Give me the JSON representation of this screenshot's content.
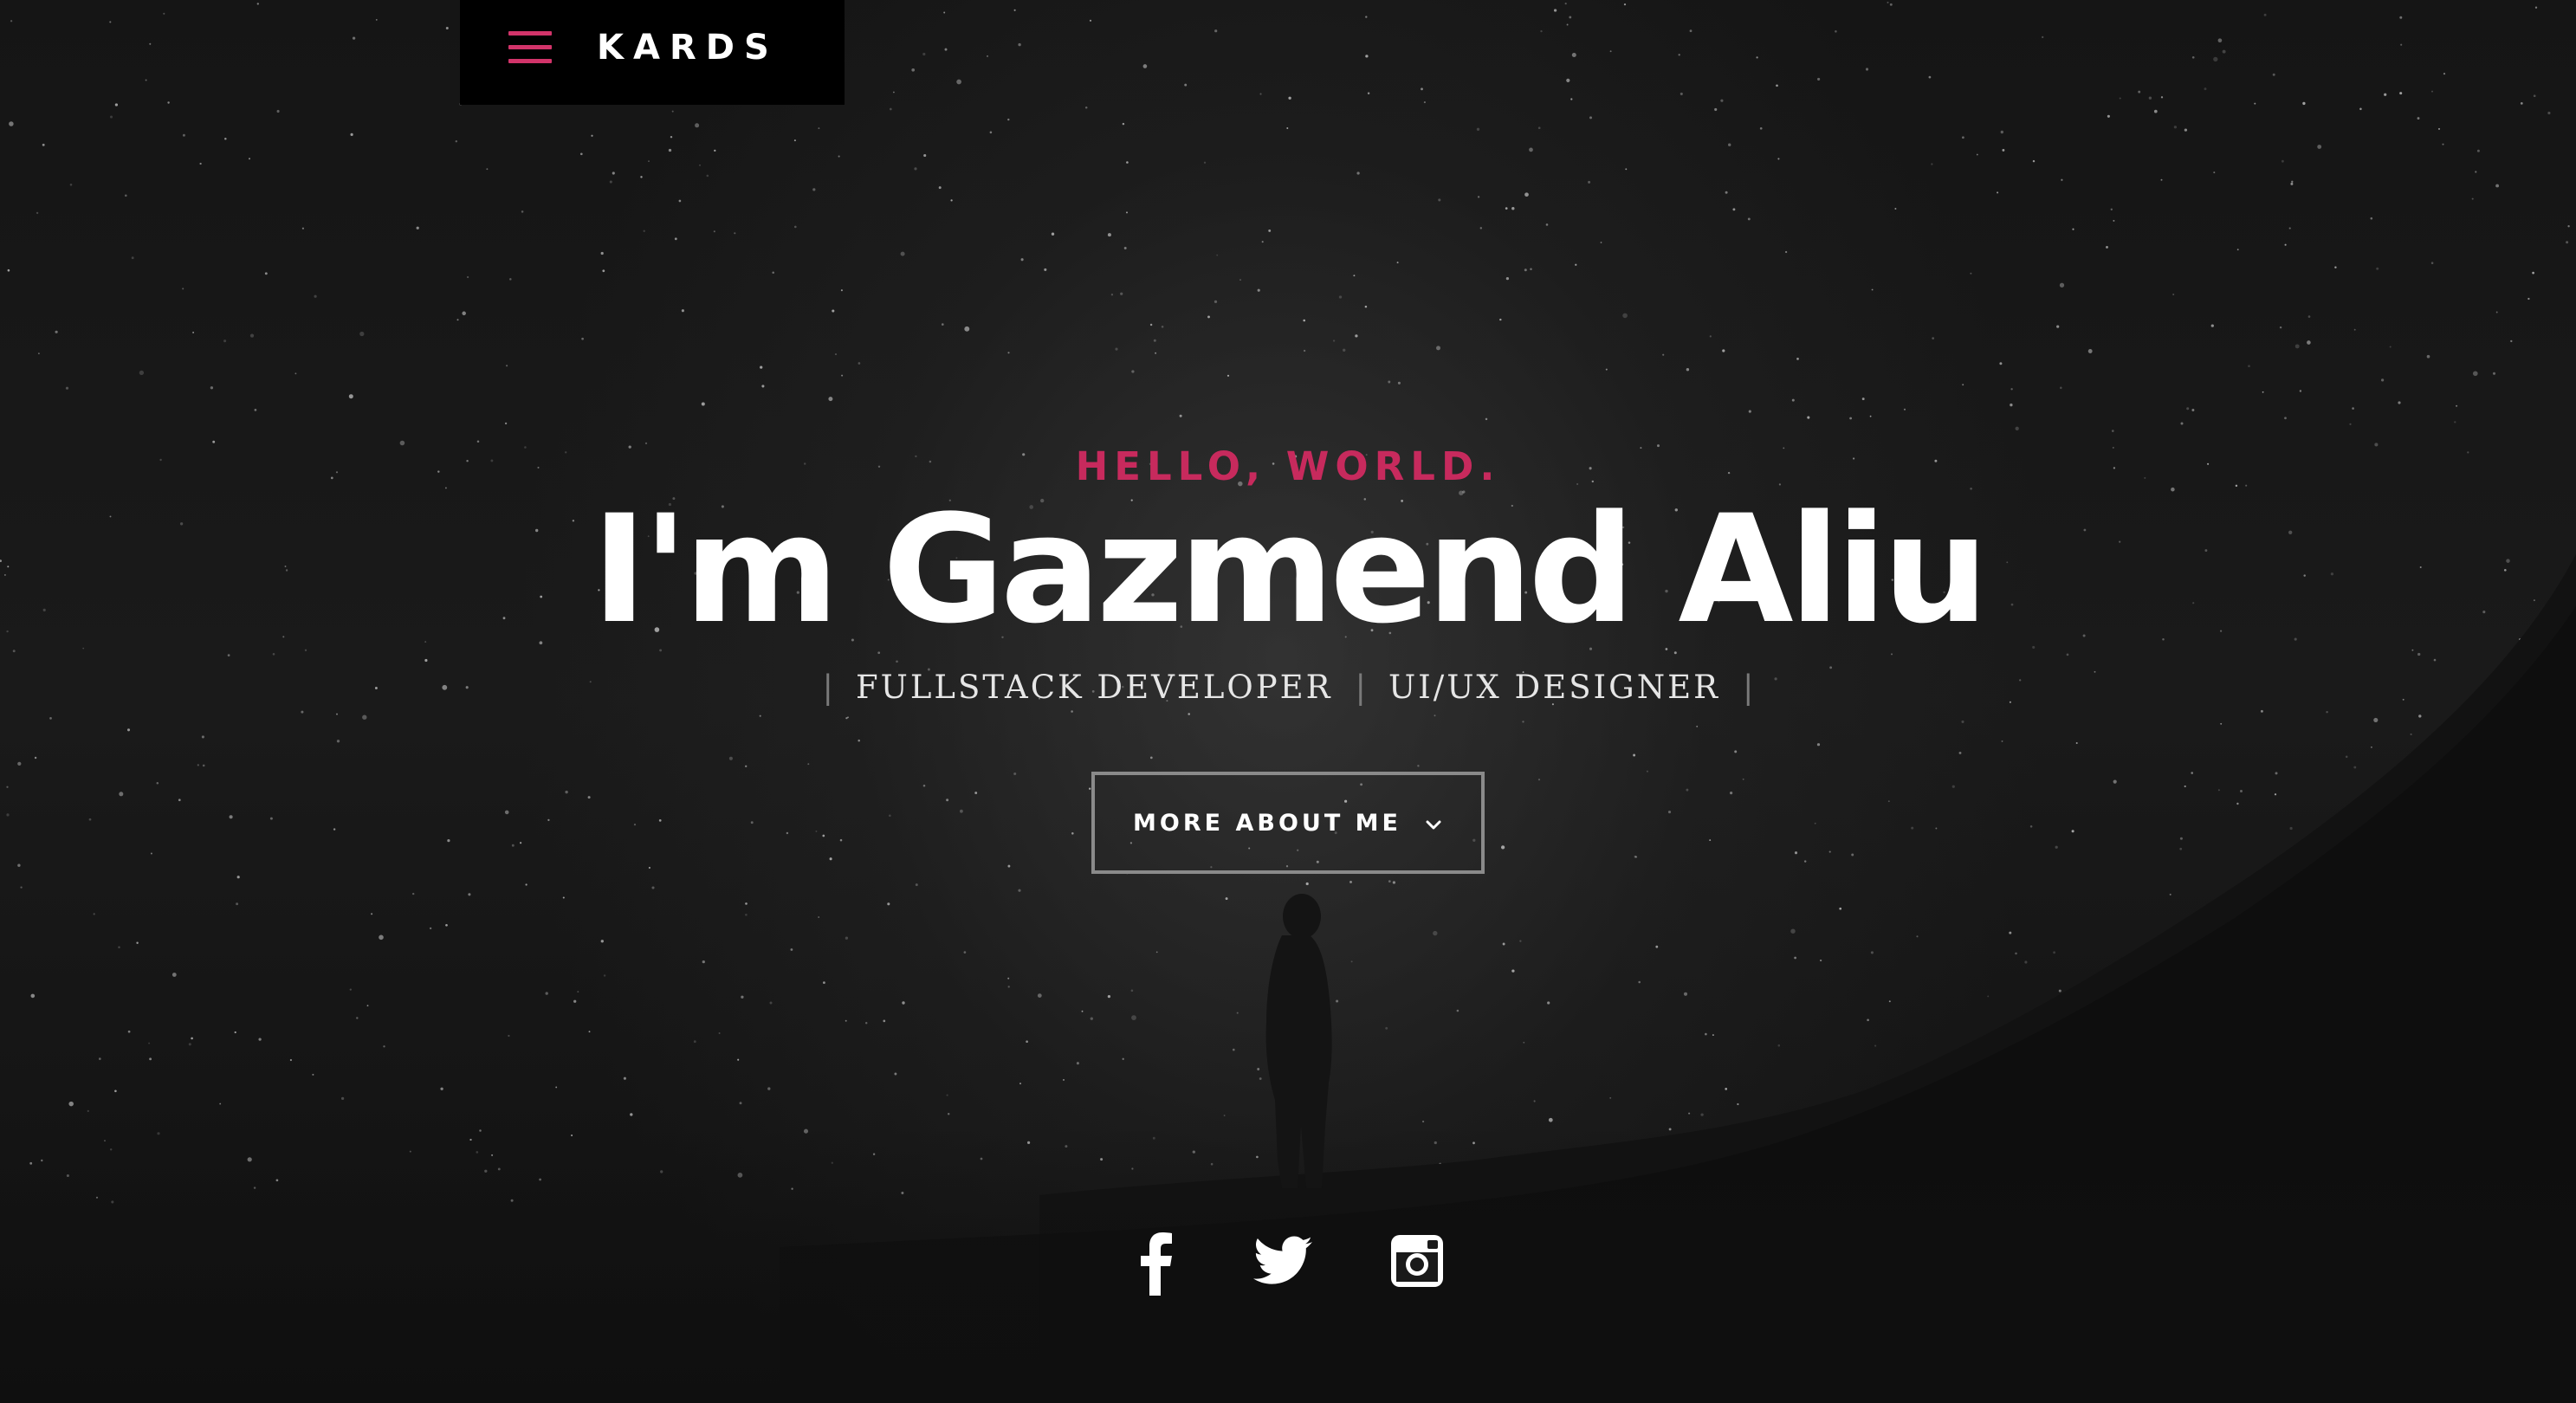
{
  "topbar": {
    "brand": "KARDS",
    "menu_icon": "hamburger-icon",
    "accent_color": "#d2346a"
  },
  "hero": {
    "kicker": "HELLO, WORLD.",
    "name": "I'm Gazmend Aliu",
    "roles": [
      "FULLSTACK DEVELOPER",
      "UI/UX DESIGNER"
    ],
    "role_separator": "|",
    "cta_label": "MORE ABOUT ME",
    "cta_icon": "chevron-down-icon"
  },
  "social": [
    {
      "icon": "facebook-icon"
    },
    {
      "icon": "twitter-icon"
    },
    {
      "icon": "instagram-icon"
    }
  ]
}
